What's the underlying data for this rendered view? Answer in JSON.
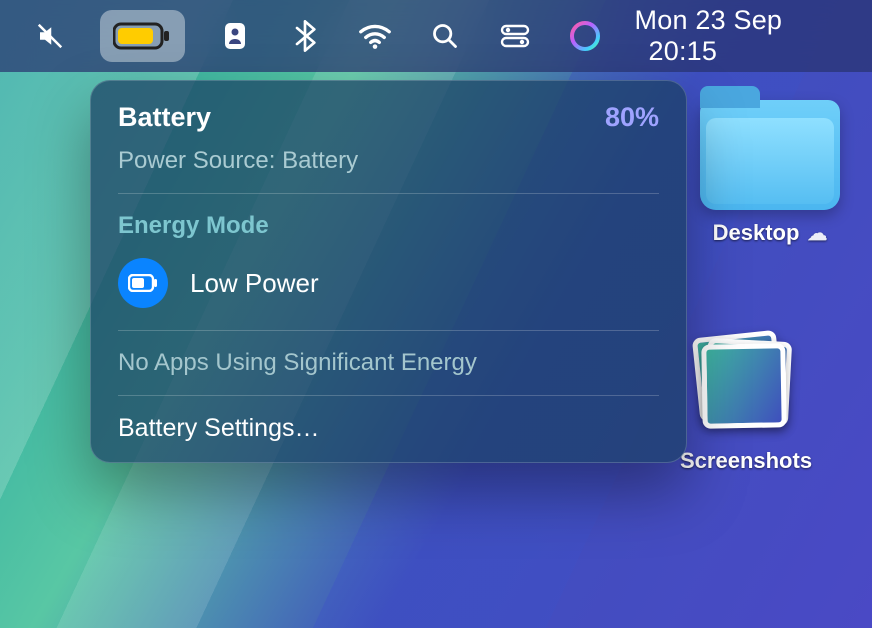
{
  "menubar": {
    "datetime": {
      "day_date": "Mon 23 Sep",
      "time": "20:15"
    }
  },
  "battery_panel": {
    "title": "Battery",
    "percentage": "80%",
    "power_source": "Power Source: Battery",
    "energy_mode_heading": "Energy Mode",
    "energy_mode_selected": "Low Power",
    "no_apps_msg": "No Apps Using Significant Energy",
    "settings_label": "Battery Settings…"
  },
  "desktop": {
    "folder1_label": "Desktop",
    "stack_label": "Screenshots"
  },
  "colors": {
    "accent_blue": "#0a84ff",
    "battery_fill": "#ffcc00",
    "percent_text": "#9fa3ff"
  }
}
